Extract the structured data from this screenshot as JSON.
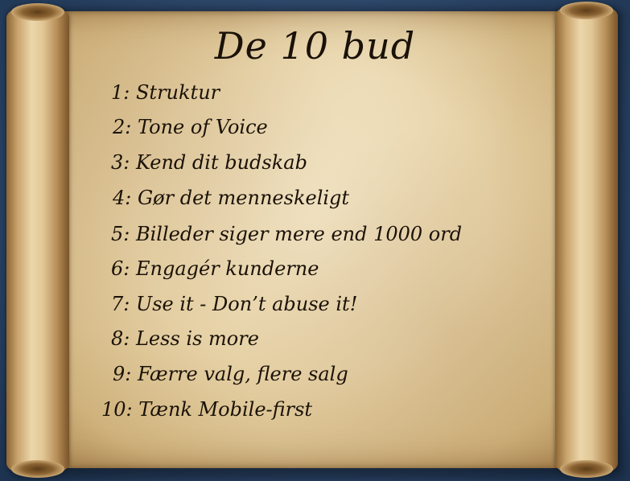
{
  "slide": {
    "title": "De 10 bud",
    "rules": [
      "1: Struktur",
      "2: Tone of Voice",
      "3: Kend dit budskab",
      "4: Gør det menneskeligt",
      "5: Billeder siger mere end 1000 ord",
      "6: Engagér kunderne",
      "7: Use it - Don’t abuse it!",
      "8: Less is more",
      "9: Færre valg, flere salg",
      "10: Tænk Mobile-first"
    ]
  },
  "colors": {
    "background": "#2c4669",
    "parchment": "#e6d1a6",
    "ink": "#1a1208"
  }
}
